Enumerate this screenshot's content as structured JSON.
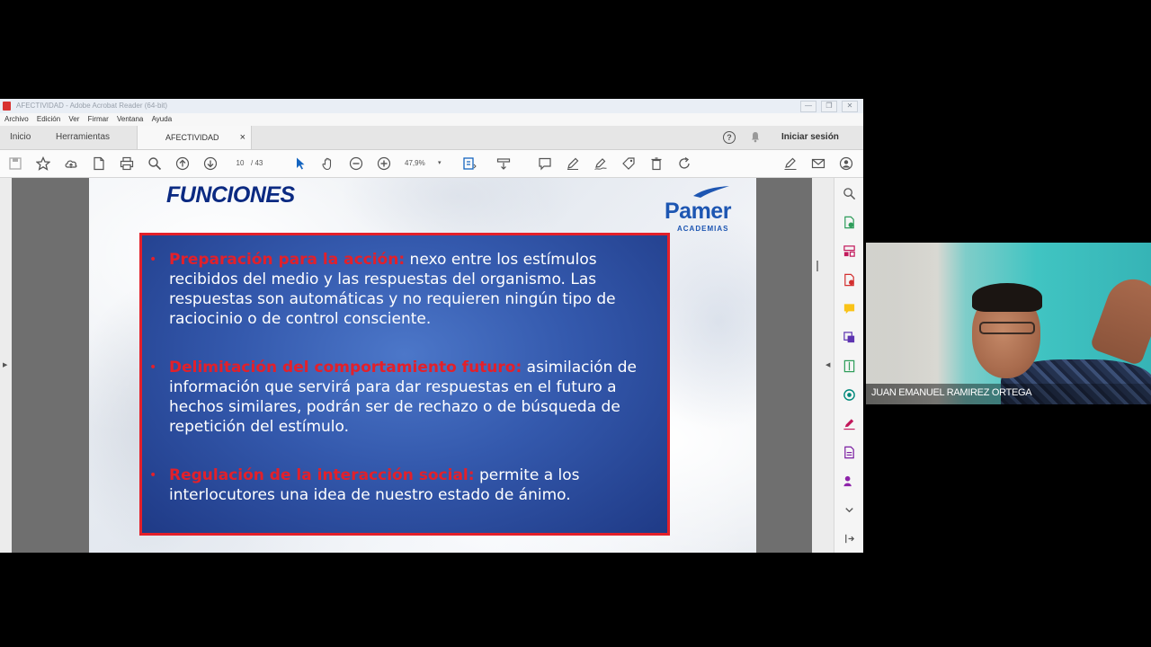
{
  "window": {
    "title": "AFECTIVIDAD - Adobe Acrobat Reader (64-bit)",
    "controls": [
      "—",
      "❐",
      "✕"
    ]
  },
  "menu": [
    "Archivo",
    "Edición",
    "Ver",
    "Firmar",
    "Ventana",
    "Ayuda"
  ],
  "tabs": {
    "home": "Inicio",
    "tools": "Herramientas",
    "document": "AFECTIVIDAD",
    "close": "×"
  },
  "header": {
    "help": "?",
    "signin": "Iniciar sesión"
  },
  "toolbar": {
    "page_current": "10",
    "page_total": "/ 43",
    "zoom": "47,9%",
    "zoom_caret": "▾"
  },
  "slide": {
    "title": "FUNCIONES",
    "logo_brand": "Pamer",
    "logo_sub": "ACADEMIAS",
    "bullets": [
      {
        "heading": "Preparación para la acción:",
        "text": " nexo entre los estímulos recibidos del medio y las respuestas del organismo. Las respuestas son automáticas y no requieren ningún tipo de raciocinio o de control consciente."
      },
      {
        "heading": "Delimitación del comportamiento futuro:",
        "text": " asimilación de información que servirá para dar respuestas en el futuro a hechos similares, podrán ser de rechazo o de búsqueda de repetición del estímulo."
      },
      {
        "heading": "Regulación de la interacción social:",
        "text": " permite a los interlocutores una idea de nuestro estado de ánimo."
      }
    ]
  },
  "webcam": {
    "participant_name": "JUAN EMANUEL RAMIREZ ORTEGA"
  },
  "colors": {
    "slide_title": "#0b2a82",
    "box_border": "#e3202a",
    "box_fill": "#3459ad",
    "logo": "#1d56b2"
  }
}
